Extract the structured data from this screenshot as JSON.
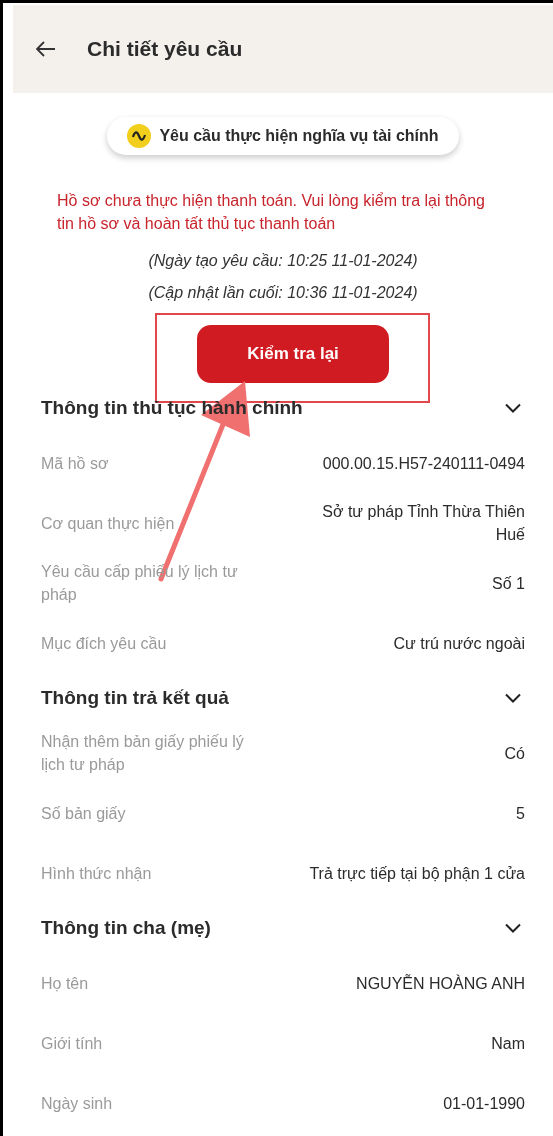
{
  "header": {
    "title": "Chi tiết yêu cầu"
  },
  "status_chip": {
    "label": "Yêu cầu thực hiện nghĩa vụ tài chính"
  },
  "warning": "Hồ sơ chưa thực hiện thanh toán. Vui lòng kiểm tra lại thông tin hồ sơ và hoàn tất thủ tục thanh toán",
  "timestamps": [
    "(Ngày tạo yêu cầu: 10:25 11-01-2024)",
    "(Cập nhật lần cuối: 10:36 11-01-2024)"
  ],
  "action_button": {
    "label": "Kiểm tra lại"
  },
  "sections": [
    {
      "title": "Thông tin thủ tục hành chính",
      "expanded": true,
      "rows": [
        {
          "label": "Mã hồ sơ",
          "value": "000.00.15.H57-240111-0494"
        },
        {
          "label": "Cơ quan thực hiện",
          "value": "Sở tư pháp Tỉnh Thừa Thiên Huế"
        },
        {
          "label": "Yêu cầu cấp phiếu lý lịch tư pháp",
          "value": "Số 1"
        },
        {
          "label": "Mục đích yêu cầu",
          "value": "Cư trú nước ngoài"
        }
      ]
    },
    {
      "title": "Thông tin trả kết quả",
      "expanded": true,
      "rows": [
        {
          "label": "Nhận thêm bản giấy phiếu lý lịch tư pháp",
          "value": "Có"
        },
        {
          "label": "Số bản giấy",
          "value": "5"
        },
        {
          "label": "Hình thức nhận",
          "value": "Trả trực tiếp tại bộ phận 1 cửa"
        }
      ]
    },
    {
      "title": "Thông tin cha (mẹ)",
      "expanded": true,
      "rows": [
        {
          "label": "Họ tên",
          "value": "NGUYỄN HOÀNG ANH"
        },
        {
          "label": "Giới tính",
          "value": "Nam"
        },
        {
          "label": "Ngày sinh",
          "value": "01-01-1990"
        }
      ]
    }
  ]
}
